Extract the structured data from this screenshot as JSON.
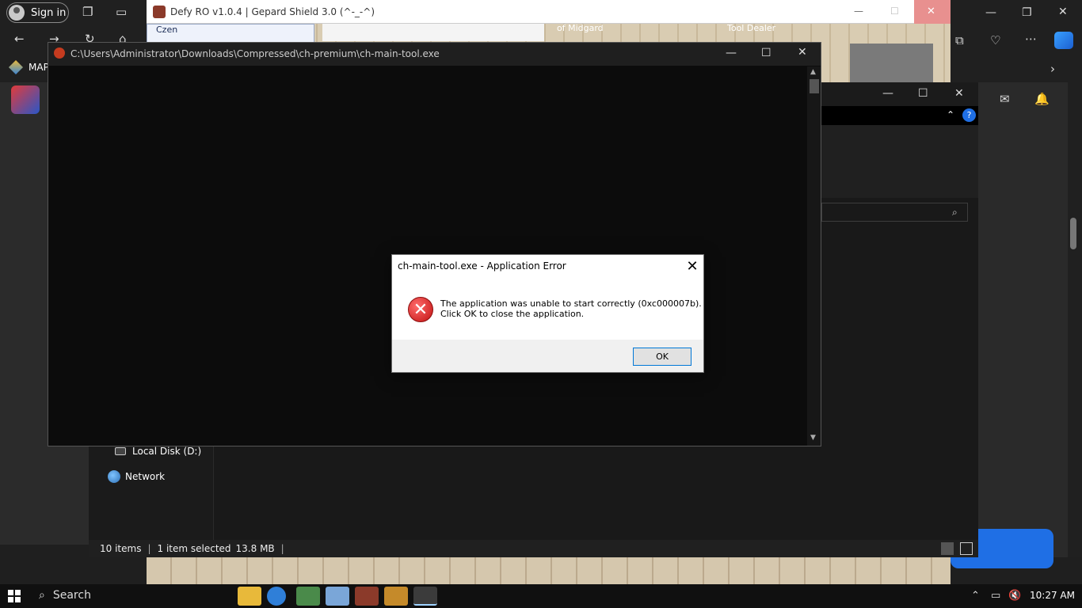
{
  "browser": {
    "sign_in_label": "Sign in",
    "favorite_label": "MAP"
  },
  "game": {
    "title": "Defy RO v1.0.4 | Gepard Shield 3.0 (^-_-^)",
    "character": "Czen",
    "map_label": "of Midgard",
    "npc_label": "Tool Dealer"
  },
  "console": {
    "path": "C:\\Users\\Administrator\\Downloads\\Compressed\\ch-premium\\ch-main-tool.exe"
  },
  "dialog": {
    "title": "ch-main-tool.exe - Application Error",
    "message_line1": "The application was unable to start correctly (0xc000007b).",
    "message_line2": "Click OK to close the application.",
    "ok_label": "OK"
  },
  "explorer": {
    "nav_items": [
      {
        "label": "Local Disk (D:)"
      },
      {
        "label": "Network"
      }
    ],
    "status": {
      "items_count": "10 items",
      "selected": "1 item selected",
      "size": "13.8 MB"
    }
  },
  "taskbar": {
    "search_label": "Search",
    "clock": "10:27 AM"
  },
  "colors": {
    "accent": "#0078d7",
    "error": "#c11212"
  }
}
